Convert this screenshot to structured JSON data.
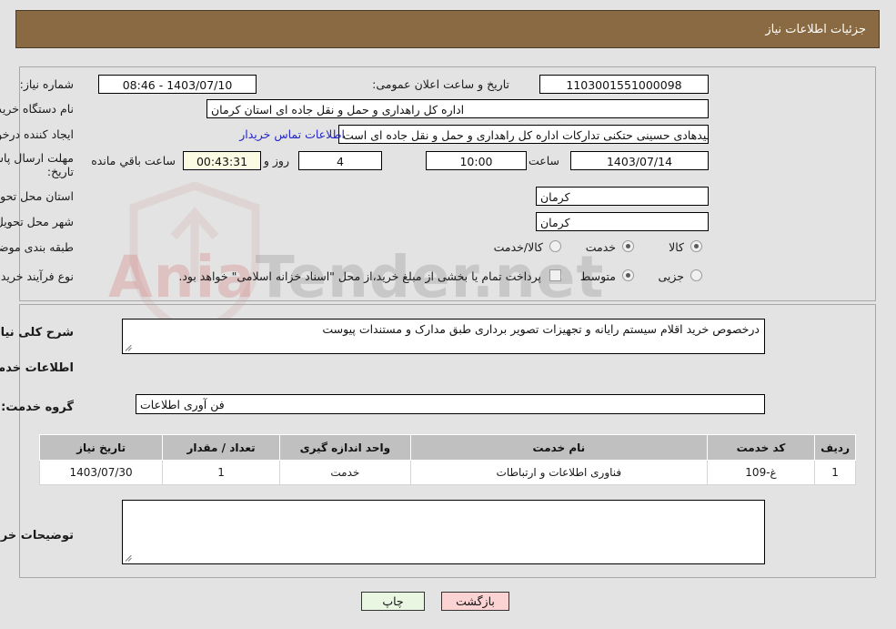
{
  "header": {
    "title": "جزئیات اطلاعات نیاز"
  },
  "watermark": {
    "text_left": "Ania",
    "text_right": "Tender.net"
  },
  "form": {
    "need_number_label": "شماره نیاز:",
    "need_number_value": "1103001551000098",
    "public_announce_label": "تاریخ و ساعت اعلان عمومی:",
    "public_announce_value": "1403/07/10 - 08:46",
    "buyer_org_label": "نام دستگاه خریدار:",
    "buyer_org_value": "اداره کل راهداری و حمل و نقل جاده ای استان کرمان",
    "creator_label": "ایجاد کننده درخواست:",
    "creator_value": "سیدهادی حسینی حتکنی تدارکات اداره کل راهداری و حمل و نقل جاده ای است",
    "contact_link": "اطلاعات تماس خریدار",
    "deadline_label_line1": "مهلت ارسال پاسخ: تا",
    "deadline_label_line2": "تاریخ:",
    "deadline_date": "1403/07/14",
    "hour_label": "ساعت",
    "deadline_time": "10:00",
    "days_value": "4",
    "days_and_label": "روز و",
    "countdown_value": "00:43:31",
    "remaining_label": "ساعت باقي مانده",
    "province_label": "استان محل تحویل:",
    "province_value": "کرمان",
    "city_label": "شهر محل تحویل:",
    "city_value": "کرمان",
    "category_label": "طبقه بندی موضوعی:",
    "category_options": [
      {
        "label": "کالا",
        "selected": false
      },
      {
        "label": "خدمت",
        "selected": true
      },
      {
        "label": "کالا/خدمت",
        "selected": false
      }
    ],
    "process_label": "نوع فرآیند خرید :",
    "process_options": [
      {
        "label": "جزیی",
        "selected": false
      },
      {
        "label": "متوسط",
        "selected": true
      }
    ],
    "treasury_checkbox_checked": false,
    "treasury_text": "پرداخت تمام یا بخشی از مبلغ خرید،از محل \"اسناد خزانه اسلامی\" خواهد بود."
  },
  "description": {
    "label": "شرح کلی نیاز:",
    "value": "درخصوص خرید اقلام سیستم رایانه و تجهیزات تصویر برداری طبق مدارک و مستندات پیوست"
  },
  "services": {
    "section_title": "اطلاعات خدمات مورد نیاز",
    "group_label": "گروه خدمت:",
    "group_value": "فن آوری اطلاعات",
    "columns": [
      "ردیف",
      "کد خدمت",
      "نام خدمت",
      "واحد اندازه گیری",
      "تعداد / مقدار",
      "تاریخ نیاز"
    ],
    "rows": [
      {
        "row_no": "1",
        "code": "غ-109",
        "name": "فناوری اطلاعات و ارتباطات",
        "unit": "خدمت",
        "qty": "1",
        "need_date": "1403/07/30"
      }
    ]
  },
  "buyer_notes": {
    "label": "توضیحات خریدار:",
    "value": ""
  },
  "footer": {
    "back_label": "بازگشت",
    "print_label": "چاپ"
  }
}
